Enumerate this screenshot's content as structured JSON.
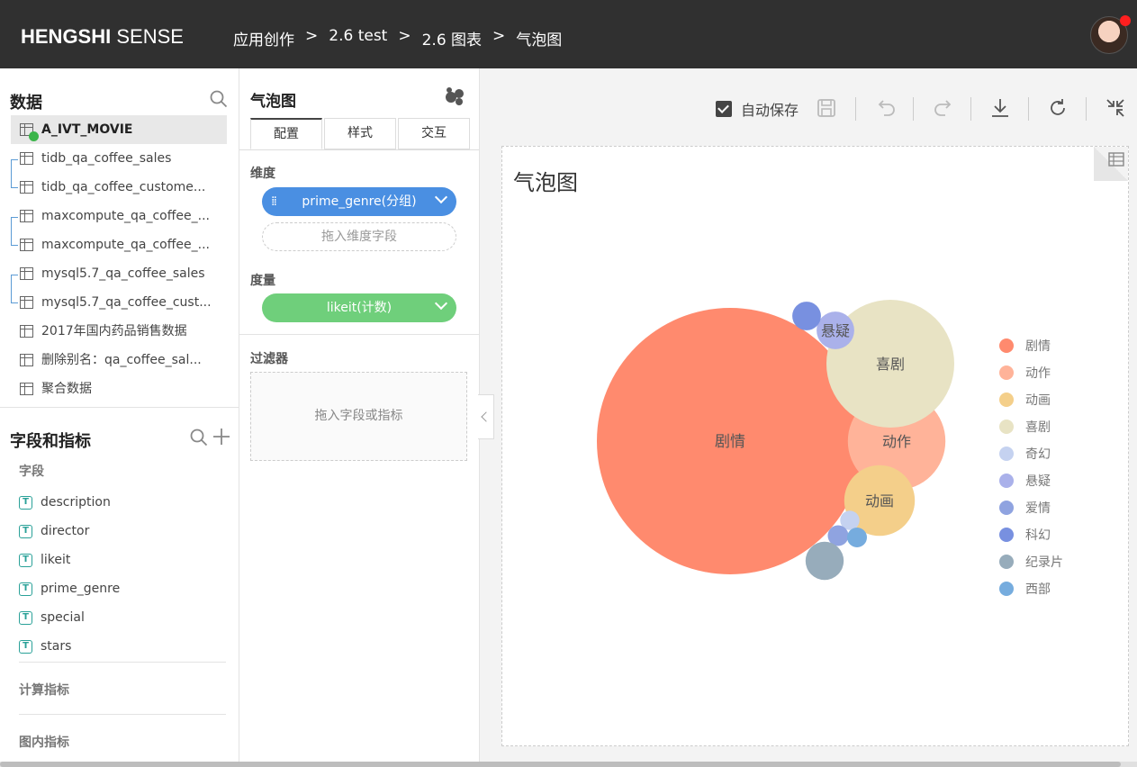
{
  "header": {
    "logo_bold": "HENGSHI",
    "logo_light": " SENSE",
    "breadcrumb": [
      "应用创作",
      "2.6 test",
      "2.6 图表",
      "气泡图"
    ],
    "separator": ">"
  },
  "data_panel": {
    "title": "数据",
    "datasets": [
      {
        "label": "A_IVT_MOVIE",
        "active": true
      },
      {
        "label": "tidb_qa_coffee_sales"
      },
      {
        "label": "tidb_qa_coffee_custome..."
      },
      {
        "label": "maxcompute_qa_coffee_..."
      },
      {
        "label": "maxcompute_qa_coffee_..."
      },
      {
        "label": "mysql5.7_qa_coffee_sales"
      },
      {
        "label": "mysql5.7_qa_coffee_cust..."
      },
      {
        "label": "2017年国内药品销售数据"
      },
      {
        "label": "删除别名：qa_coffee_sal..."
      },
      {
        "label": "聚合数据"
      }
    ]
  },
  "fields_panel": {
    "title": "字段和指标",
    "fields_label": "字段",
    "field_type_glyph": "T",
    "fields": [
      "description",
      "director",
      "likeit",
      "prime_genre",
      "special",
      "stars"
    ],
    "calc_label": "计算指标",
    "inchart_label": "图内指标"
  },
  "config_panel": {
    "title": "气泡图",
    "tabs": [
      "配置",
      "样式",
      "交互"
    ],
    "dimension_label": "维度",
    "dimension_field": "prime_genre(分组)",
    "dimension_drop": "拖入维度字段",
    "measure_label": "度量",
    "measure_field": "likeit(计数)",
    "filter_label": "过滤器",
    "filter_drop": "拖入字段或指标"
  },
  "toolbar": {
    "autosave_label": "自动保存",
    "autosave_checked": true
  },
  "chart": {
    "title": "气泡图"
  },
  "chart_data": {
    "type": "bubble",
    "title": "气泡图",
    "legend_position": "right",
    "series": [
      {
        "name": "剧情",
        "color": "#ff8a6e",
        "label_shown": true
      },
      {
        "name": "动作",
        "color": "#ffb399",
        "label_shown": true
      },
      {
        "name": "动画",
        "color": "#f4cf8a",
        "label_shown": true
      },
      {
        "name": "喜剧",
        "color": "#e8e3c4",
        "label_shown": true
      },
      {
        "name": "奇幻",
        "color": "#c5d2f0",
        "label_shown": false
      },
      {
        "name": "悬疑",
        "color": "#aab1ea",
        "label_shown": true
      },
      {
        "name": "爱情",
        "color": "#8fa3e0",
        "label_shown": false
      },
      {
        "name": "科幻",
        "color": "#7890e0",
        "label_shown": false
      },
      {
        "name": "纪录片",
        "color": "#97acbb",
        "label_shown": false
      },
      {
        "name": "西部",
        "color": "#76acde",
        "label_shown": false
      }
    ],
    "relative_size": [
      1.0,
      0.134,
      0.07,
      0.23,
      0.0052,
      0.02,
      0.006,
      0.0115,
      0.0205,
      0.0055
    ]
  }
}
